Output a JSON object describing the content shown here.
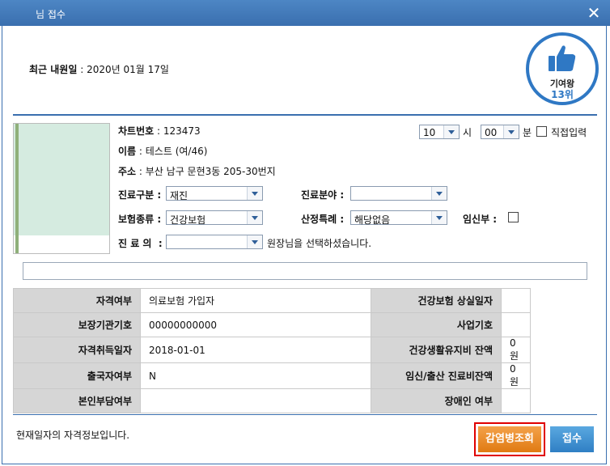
{
  "window": {
    "title": "님 접수",
    "close_label": "✕"
  },
  "header": {
    "recent_visit_label": "최근 내원일",
    "recent_visit_value": " : 2020년 01월 17일"
  },
  "badge": {
    "label": "기여왕",
    "rank": "13위",
    "icon": "thumbs-up-icon",
    "color": "#2f78c4"
  },
  "patient": {
    "chart_no_label": "차트번호",
    "chart_no_value": " : 123473",
    "name_label": "이름",
    "name_value": " : 테스트 (여/46)",
    "address_label": "주소",
    "address_value": " : 부산 남구 문현3동 205-30번지"
  },
  "time": {
    "hour": "10",
    "hour_unit": "시",
    "minute": "00",
    "minute_unit": "분",
    "manual_label": "직접입력"
  },
  "form": {
    "visit_type_label": "진료구분 :",
    "visit_type_value": "재진",
    "field_label": "진료분야 :",
    "field_value": "",
    "insurance_label": "보험종류 :",
    "insurance_value": "건강보험",
    "special_label": "산정특례 :",
    "special_value": "해당없음",
    "pregnant_label": "임신부 :",
    "doctor_label": "진 료 의  :",
    "doctor_value": "",
    "doctor_hint": "원장님을 선택하셨습니다."
  },
  "eligibility": {
    "rows": [
      {
        "k1": "자격여부",
        "v1": "의료보험 가입자",
        "k2": "건강보험 상실일자",
        "v2": ""
      },
      {
        "k1": "보장기관기호",
        "v1": "00000000000",
        "k2": "사업기호",
        "v2": ""
      },
      {
        "k1": "자격취득일자",
        "v1": "2018-01-01",
        "k2": "건강생활유지비 잔액",
        "v2": "0원"
      },
      {
        "k1": "출국자여부",
        "v1": "N",
        "k2": "임신/출산 진료비잔액",
        "v2": "0원"
      },
      {
        "k1": "본인부담여부",
        "v1": "",
        "k2": "장애인 여부",
        "v2": ""
      }
    ]
  },
  "footer": {
    "note": "현재일자의 자격정보입니다.",
    "find_button": "감염병조회",
    "receive_button": "접수"
  },
  "colors": {
    "titlebar": "#3a6faf",
    "highlight": "#e00000",
    "find_button": "#e88a24",
    "receive_button": "#2f7fc4"
  }
}
